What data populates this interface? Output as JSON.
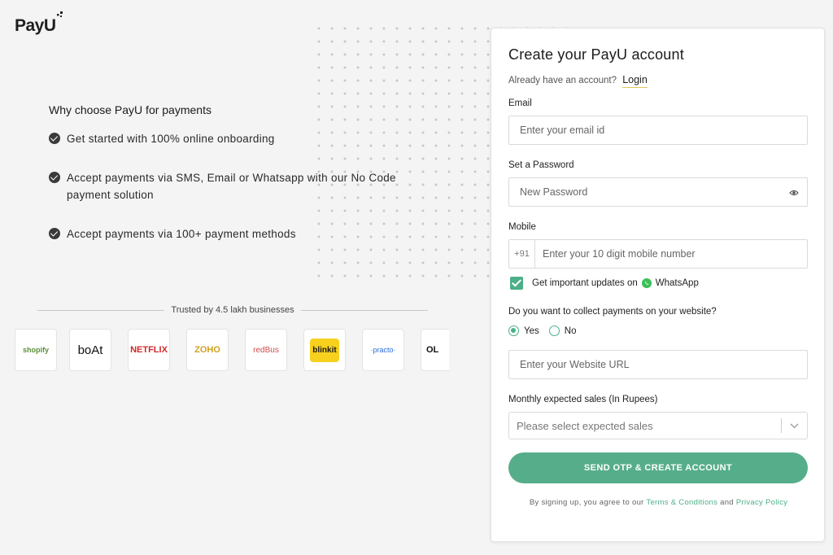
{
  "brand": {
    "logo_text": "PayU",
    "accent": "#4caf87",
    "button_color": "#56ad8a"
  },
  "why": {
    "title": "Why choose PayU for payments",
    "items": [
      "Get started with 100% online onboarding",
      "Accept payments via SMS, Email or Whatsapp with our No Code payment solution",
      "Accept payments via 100+ payment methods"
    ]
  },
  "trusted": {
    "label": "Trusted by 4.5 lakh businesses",
    "brands": [
      "shopify",
      "boAt",
      "NETFLIX",
      "ZOHO",
      "redBus",
      "blinkit",
      "·practo·",
      "OL"
    ]
  },
  "form": {
    "title": "Create your PayU account",
    "already_text": "Already have an account?",
    "login_label": "Login",
    "email_label": "Email",
    "email_placeholder": "Enter your email id",
    "password_label": "Set a Password",
    "password_placeholder": "New Password",
    "mobile_label": "Mobile",
    "mobile_prefix": "+91",
    "mobile_placeholder": "Enter your 10 digit mobile number",
    "updates_text": "Get important updates on",
    "whatsapp_label": "WhatsApp",
    "updates_checked": true,
    "website_question": "Do you want to collect payments on your website?",
    "yes_label": "Yes",
    "no_label": "No",
    "selected_option": "Yes",
    "website_placeholder": "Enter your Website URL",
    "sales_label": "Monthly expected sales (In Rupees)",
    "sales_placeholder": "Please select expected sales",
    "submit_label": "SEND OTP & CREATE ACCOUNT",
    "terms_prefix": "By signing up, you agree to our",
    "terms_link": "Terms & Conditions",
    "terms_and": "and",
    "privacy_link": "Privacy Policy"
  }
}
